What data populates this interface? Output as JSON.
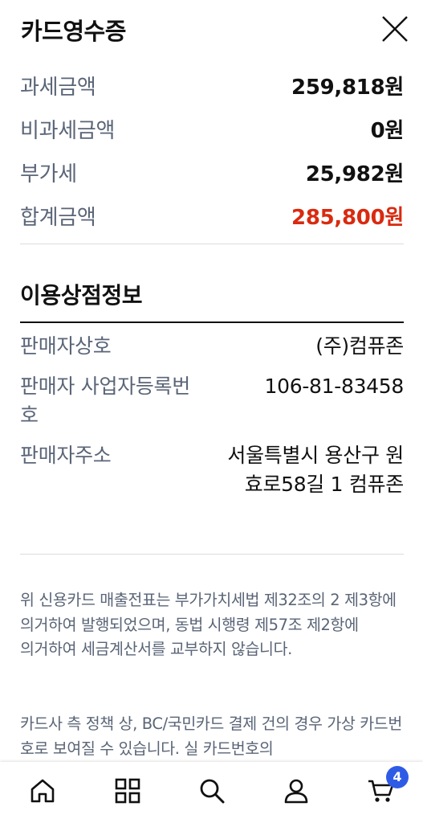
{
  "header": {
    "title": "카드영수증",
    "close_icon": "close-icon"
  },
  "amounts": [
    {
      "label": "과세금액",
      "value": "259,818원"
    },
    {
      "label": "비과세금액",
      "value": "0원"
    },
    {
      "label": "부가세",
      "value": "25,982원"
    },
    {
      "label": "합계금액",
      "value": "285,800원"
    }
  ],
  "colors": {
    "total": "#d92a10",
    "label": "#5a6577",
    "badge": "#2e5be6"
  },
  "merchant": {
    "title": "이용상점정보",
    "rows": [
      {
        "label": "판매자상호",
        "value": "(주)컴퓨존"
      },
      {
        "label": "판매자 사업자등록번호",
        "value": "106-81-83458"
      },
      {
        "label": "판매자주소",
        "value": "서울특별시 용산구 원효로58길 1 컴퓨존"
      }
    ]
  },
  "notice": {
    "paragraph1": "위 신용카드 매출전표는 부가가치세법 제32조의 2 제3항에 의거하여 발행되었으며, 동법 시행령 제57조 제2항에 의거하여 세금계산서를 교부하지 않습니다.",
    "paragraph2": "카드사 측 정책 상, BC/국민카드 결제 건의 경우 가상 카드번호로 보여질 수 있습니다. 실 카드번호의"
  },
  "bottom_nav": {
    "items": [
      "home-icon",
      "grid-icon",
      "search-icon",
      "user-icon",
      "cart-icon"
    ],
    "cart_badge": "4"
  }
}
